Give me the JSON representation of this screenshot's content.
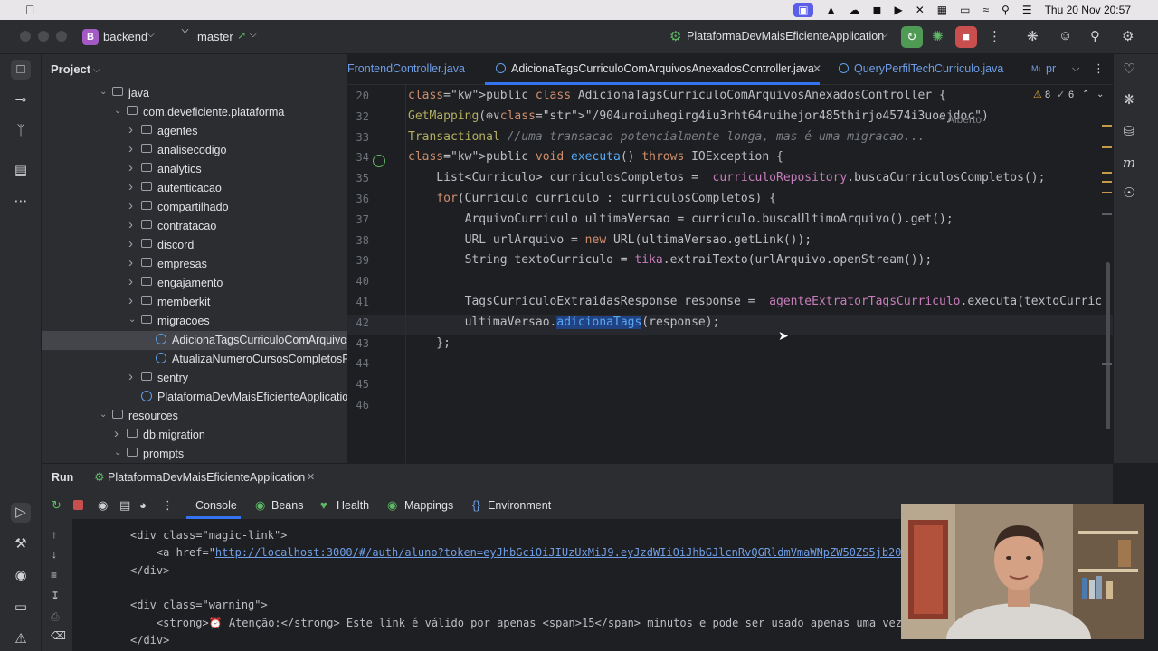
{
  "menubar": {
    "clock": "Thu 20 Nov  20:57"
  },
  "titlebar": {
    "project_badge": "B",
    "project_name": "backend",
    "branch": "master",
    "run_config": "PlataformaDevMaisEficienteApplication"
  },
  "project_panel": {
    "title": "Project",
    "tree": [
      {
        "label": "java",
        "indent": 5,
        "arrow": "open",
        "icon": "folder"
      },
      {
        "label": "com.deveficiente.plataforma",
        "indent": 6,
        "arrow": "open",
        "icon": "folder"
      },
      {
        "label": "agentes",
        "indent": 7,
        "arrow": "closed",
        "icon": "folder"
      },
      {
        "label": "analisecodigo",
        "indent": 7,
        "arrow": "closed",
        "icon": "folder"
      },
      {
        "label": "analytics",
        "indent": 7,
        "arrow": "closed",
        "icon": "folder"
      },
      {
        "label": "autenticacao",
        "indent": 7,
        "arrow": "closed",
        "icon": "folder"
      },
      {
        "label": "compartilhado",
        "indent": 7,
        "arrow": "closed",
        "icon": "folder"
      },
      {
        "label": "contratacao",
        "indent": 7,
        "arrow": "closed",
        "icon": "folder"
      },
      {
        "label": "discord",
        "indent": 7,
        "arrow": "closed",
        "icon": "folder"
      },
      {
        "label": "empresas",
        "indent": 7,
        "arrow": "closed",
        "icon": "folder"
      },
      {
        "label": "engajamento",
        "indent": 7,
        "arrow": "closed",
        "icon": "folder"
      },
      {
        "label": "memberkit",
        "indent": 7,
        "arrow": "closed",
        "icon": "folder"
      },
      {
        "label": "migracoes",
        "indent": 7,
        "arrow": "open",
        "icon": "folder"
      },
      {
        "label": "AdicionaTagsCurriculoComArquivos",
        "indent": 8,
        "arrow": "",
        "icon": "class",
        "selected": true
      },
      {
        "label": "AtualizaNumeroCursosCompletosPr",
        "indent": 8,
        "arrow": "",
        "icon": "class"
      },
      {
        "label": "sentry",
        "indent": 7,
        "arrow": "closed",
        "icon": "folder"
      },
      {
        "label": "PlataformaDevMaisEficienteApplication",
        "indent": 7,
        "arrow": "",
        "icon": "class"
      },
      {
        "label": "resources",
        "indent": 5,
        "arrow": "open",
        "icon": "folder"
      },
      {
        "label": "db.migration",
        "indent": 6,
        "arrow": "closed",
        "icon": "folder"
      },
      {
        "label": "prompts",
        "indent": 6,
        "arrow": "open",
        "icon": "folder"
      }
    ]
  },
  "editor": {
    "tabs": [
      {
        "label": "FrontendController.java",
        "state": "inactive"
      },
      {
        "label": "AdicionaTagsCurriculoComArquivosAnexadosController.java",
        "state": "active"
      },
      {
        "label": "QueryPerfilTechCurriculo.java",
        "state": "inactive"
      },
      {
        "label": "pr",
        "state": "inactive"
      }
    ],
    "warnings_count": "8",
    "checks_count": "6",
    "author_hint": "Alberto",
    "lines": [
      {
        "num": "20",
        "text": "public class AdicionaTagsCurriculoComArquivosAnexadosController {"
      },
      {
        "num": "32",
        "text": "GetMapping(⊕∨\"/904uroiuhegirg4iu3rht64ruihejor485thirjo4574i3uoejdoc\")"
      },
      {
        "num": "33",
        "text": "Transactional //uma transacao potencialmente longa, mas é uma migracao..."
      },
      {
        "num": "34",
        "text": "public void executa() throws IOException {"
      },
      {
        "num": "35",
        "text": "    List<Curriculo> curriculosCompletos =  curriculoRepository.buscaCurriculosCompletos();"
      },
      {
        "num": "36",
        "text": "    for(Curriculo curriculo : curriculosCompletos) {"
      },
      {
        "num": "37",
        "text": "        ArquivoCurriculo ultimaVersao = curriculo.buscaUltimoArquivo().get();"
      },
      {
        "num": "38",
        "text": "        URL urlArquivo = new URL(ultimaVersao.getLink());"
      },
      {
        "num": "39",
        "text": "        String textoCurriculo = tika.extraiTexto(urlArquivo.openStream());"
      },
      {
        "num": "40",
        "text": ""
      },
      {
        "num": "41",
        "text": "        TagsCurriculoExtraidasResponse response =  agenteExtratorTagsCurriculo.executa(textoCurric"
      },
      {
        "num": "42",
        "text": "        ultimaVersao.adicionaTags(response);"
      },
      {
        "num": "43",
        "text": "    };"
      },
      {
        "num": "44",
        "text": ""
      },
      {
        "num": "45",
        "text": ""
      },
      {
        "num": "46",
        "text": ""
      }
    ]
  },
  "run_panel": {
    "title": "Run",
    "config_tab": "PlataformaDevMaisEficienteApplication",
    "tabs": [
      "Console",
      "Beans",
      "Health",
      "Mappings",
      "Environment"
    ]
  },
  "console": {
    "line1": "<div class=\"magic-link\">",
    "line2_prefix": "    <a href=\"",
    "line2_link": "http://localhost:3000/#/auth/aluno?token=eyJhbGciOiJIUzUxMiJ9.eyJzdWIiOiJhbGJlcnRvQGRldmVmaWNpZW50ZS5jb20iLCJ0eX",
    "line3": "</div>",
    "line4": "<div class=\"warning\">",
    "line5": "    <strong>⏰ Atenção:</strong> Este link é válido por apenas <span>15</span> minutos e pode ser usado apenas uma vez.",
    "line6": "</div>"
  }
}
